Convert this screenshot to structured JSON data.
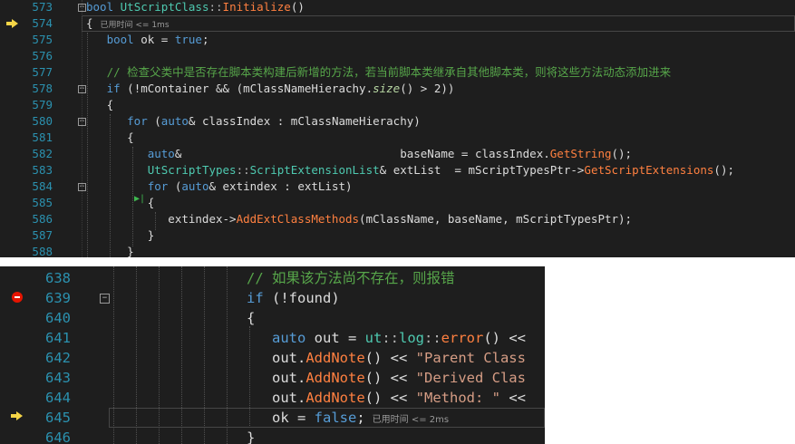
{
  "panel_top": {
    "lines": [
      {
        "n": "573",
        "parts": [
          [
            "kw",
            "bool "
          ],
          [
            "ty",
            "UtScriptClass"
          ],
          [
            "op",
            "::"
          ],
          [
            "fn2",
            "Initialize"
          ],
          [
            "",
            "()"
          ]
        ]
      },
      {
        "n": "574",
        "parts": [
          [
            "",
            "{"
          ]
        ],
        "hint": "已用时间 <= 1ms"
      },
      {
        "n": "575",
        "parts": [
          [
            "",
            "   "
          ],
          [
            "kw",
            "bool"
          ],
          [
            "",
            " ok = "
          ],
          [
            "kw",
            "true"
          ],
          [
            "",
            ";"
          ]
        ]
      },
      {
        "n": "576",
        "parts": []
      },
      {
        "n": "577",
        "parts": [
          [
            "",
            "   "
          ],
          [
            "cm",
            "// 检查父类中是否存在脚本类构建后新增的方法，若当前脚本类继承自其他脚本类，则将这些方法动态添加进来"
          ]
        ]
      },
      {
        "n": "578",
        "parts": [
          [
            "",
            "   "
          ],
          [
            "kw",
            "if"
          ],
          [
            "",
            " (!mContainer && (mClassNameHierachy."
          ],
          [
            "fi",
            "size"
          ],
          [
            "",
            "() > 2))"
          ]
        ]
      },
      {
        "n": "579",
        "parts": [
          [
            "",
            "   {"
          ]
        ]
      },
      {
        "n": "580",
        "parts": [
          [
            "",
            "      "
          ],
          [
            "kw",
            "for"
          ],
          [
            "",
            " ("
          ],
          [
            "kw",
            "auto"
          ],
          [
            "",
            "& classIndex : mClassNameHierachy)"
          ]
        ]
      },
      {
        "n": "581",
        "parts": [
          [
            "",
            "      {"
          ]
        ]
      },
      {
        "n": "582",
        "parts": [
          [
            "",
            "         "
          ],
          [
            "kw",
            "auto"
          ],
          [
            "",
            "&                                baseName = classIndex."
          ],
          [
            "fn2",
            "GetString"
          ],
          [
            "",
            "();"
          ]
        ]
      },
      {
        "n": "583",
        "parts": [
          [
            "",
            "         "
          ],
          [
            "ty",
            "UtScriptTypes"
          ],
          [
            "op",
            "::"
          ],
          [
            "ty",
            "ScriptExtensionList"
          ],
          [
            "",
            "& extList  = mScriptTypesPtr->"
          ],
          [
            "fn2",
            "GetScriptExtensions"
          ],
          [
            "",
            "();"
          ]
        ]
      },
      {
        "n": "584",
        "parts": [
          [
            "",
            "         "
          ],
          [
            "kw",
            "for"
          ],
          [
            "",
            " ("
          ],
          [
            "kw",
            "auto"
          ],
          [
            "",
            "& extindex : extList)"
          ]
        ]
      },
      {
        "n": "585",
        "parts": [
          [
            "",
            "         {"
          ]
        ]
      },
      {
        "n": "586",
        "parts": [
          [
            "",
            "            extindex->"
          ],
          [
            "fn2",
            "AddExtClassMethods"
          ],
          [
            "",
            "(mClassName, baseName, mScriptTypesPtr);"
          ]
        ]
      },
      {
        "n": "587",
        "parts": [
          [
            "",
            "         }"
          ]
        ]
      },
      {
        "n": "588",
        "parts": [
          [
            "",
            "      }"
          ]
        ]
      }
    ]
  },
  "panel_bottom": {
    "lines": [
      {
        "n": "638",
        "parts": [
          [
            "cm",
            "// 如果该方法尚不存在，则报错"
          ]
        ]
      },
      {
        "n": "639",
        "parts": [
          [
            "kw",
            "if"
          ],
          [
            "",
            " (!found)"
          ]
        ]
      },
      {
        "n": "640",
        "parts": [
          [
            "",
            "{"
          ]
        ]
      },
      {
        "n": "641",
        "parts": [
          [
            "",
            "   "
          ],
          [
            "kw",
            "auto"
          ],
          [
            "",
            " out = "
          ],
          [
            "ty",
            "ut"
          ],
          [
            "op",
            "::"
          ],
          [
            "ty",
            "log"
          ],
          [
            "op",
            "::"
          ],
          [
            "fn2",
            "error"
          ],
          [
            "",
            "() <<"
          ]
        ]
      },
      {
        "n": "642",
        "parts": [
          [
            "",
            "   out."
          ],
          [
            "fn2",
            "AddNote"
          ],
          [
            "",
            "() << "
          ],
          [
            "st",
            "\"Parent Class"
          ]
        ]
      },
      {
        "n": "643",
        "parts": [
          [
            "",
            "   out."
          ],
          [
            "fn2",
            "AddNote"
          ],
          [
            "",
            "() << "
          ],
          [
            "st",
            "\"Derived Clas"
          ]
        ]
      },
      {
        "n": "644",
        "parts": [
          [
            "",
            "   out."
          ],
          [
            "fn2",
            "AddNote"
          ],
          [
            "",
            "() << "
          ],
          [
            "st",
            "\"Method: \""
          ],
          [
            "",
            " <<"
          ]
        ]
      },
      {
        "n": "645",
        "parts": [
          [
            "",
            "   ok = "
          ],
          [
            "kw",
            "false"
          ],
          [
            "",
            ";"
          ]
        ],
        "hint": "已用时间 <= 2ms"
      },
      {
        "n": "646",
        "parts": [
          [
            "",
            "}"
          ]
        ]
      }
    ]
  }
}
